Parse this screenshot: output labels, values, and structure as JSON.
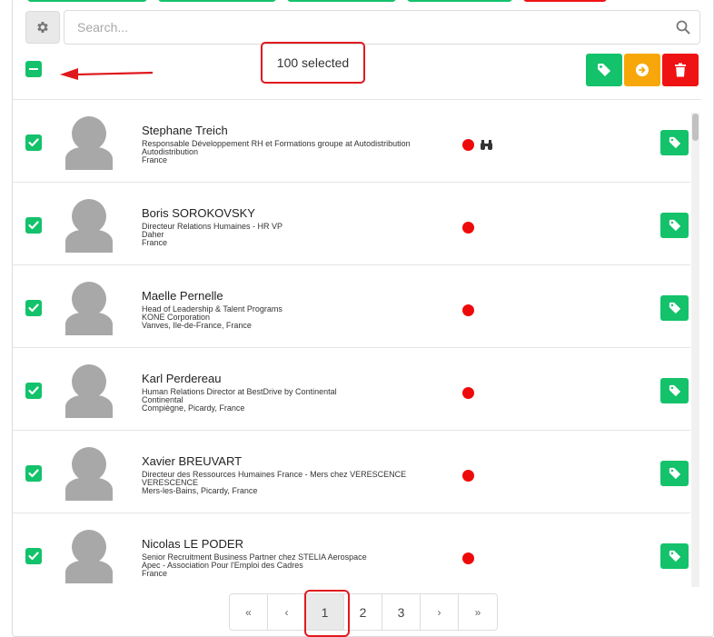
{
  "search": {
    "placeholder": "Search..."
  },
  "selection": {
    "count_label": "100 selected"
  },
  "colors": {
    "green": "#13c26b",
    "orange": "#f7a70a",
    "red": "#ef1212",
    "highlight": "#e0191e"
  },
  "people": [
    {
      "name": "Stephane Treich",
      "title": "Responsable Développement RH et Formations groupe at Autodistribution",
      "company": "Autodistribution",
      "location": "France",
      "binoculars": true
    },
    {
      "name": "Boris SOROKOVSKY",
      "title": "Directeur Relations Humaines - HR VP",
      "company": "Daher",
      "location": "France",
      "binoculars": false
    },
    {
      "name": "Maelle Pernelle",
      "title": "Head of Leadership & Talent Programs",
      "company": "KONE Corporation",
      "location": "Vanves, Ile-de-France, France",
      "binoculars": false
    },
    {
      "name": "Karl Perdereau",
      "title": "Human Relations Director at BestDrive by Continental",
      "company": "Continental",
      "location": "Compiègne, Picardy, France",
      "binoculars": false
    },
    {
      "name": "Xavier BREUVART",
      "title": "Directeur des Ressources Humaines France - Mers chez VERESCENCE",
      "company": "VERESCENCE",
      "location": "Mers-les-Bains, Picardy, France",
      "binoculars": false
    },
    {
      "name": "Nicolas LE PODER",
      "title": "Senior Recruitment Business Partner chez STELIA Aerospace",
      "company": "Apec - Association Pour l'Emploi des Cadres",
      "location": "France",
      "binoculars": false
    }
  ],
  "pagination": {
    "first": "«",
    "prev": "‹",
    "next": "›",
    "last": "»",
    "pages": [
      "1",
      "2",
      "3"
    ],
    "current": "1"
  }
}
